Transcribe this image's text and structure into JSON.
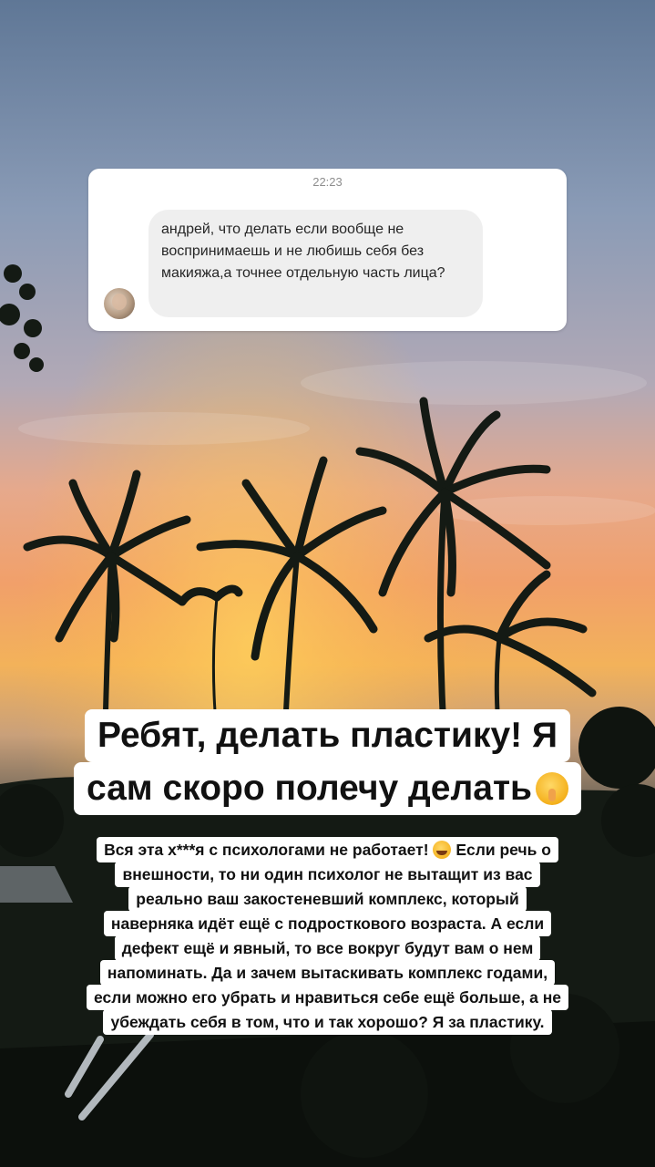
{
  "message": {
    "time": "22:23",
    "text": "андрей, что делать если вообще не воспринимаешь и не любишь себя без макияжа,а точнее отдельную часть лица?"
  },
  "caption_big": {
    "line1": "Ребят, делать пластику! Я",
    "line2": "сам скоро полечу делать"
  },
  "caption_small": {
    "line1_a": "Вся эта х***я с психологами не работает!",
    "line1_b": "Если речь о",
    "line2": "внешности, то ни один психолог не вытащит из вас",
    "line3": "реально ваш закостеневший комплекс, который",
    "line4": "наверняка идёт ещё с подросткового возраста. А если",
    "line5": "дефект ещё и явный, то все вокруг будут вам о нем",
    "line6": "напоминать. Да и зачем вытаскивать комплекс годами,",
    "line7": "если можно его убрать и нравиться себе ещё больше, а не",
    "line8": "убеждать себя в том, что и так хорошо? Я за пластику."
  },
  "icons": {
    "avatar": "sender-avatar",
    "emoji_big": "shushing-face-emoji",
    "emoji_small": "tears-of-joy-emoji"
  },
  "colors": {
    "sky_top": "#6f86a8",
    "sunset_orange": "#f2a468",
    "sunset_yellow": "#f6c84a",
    "silhouette": "#141a14"
  }
}
